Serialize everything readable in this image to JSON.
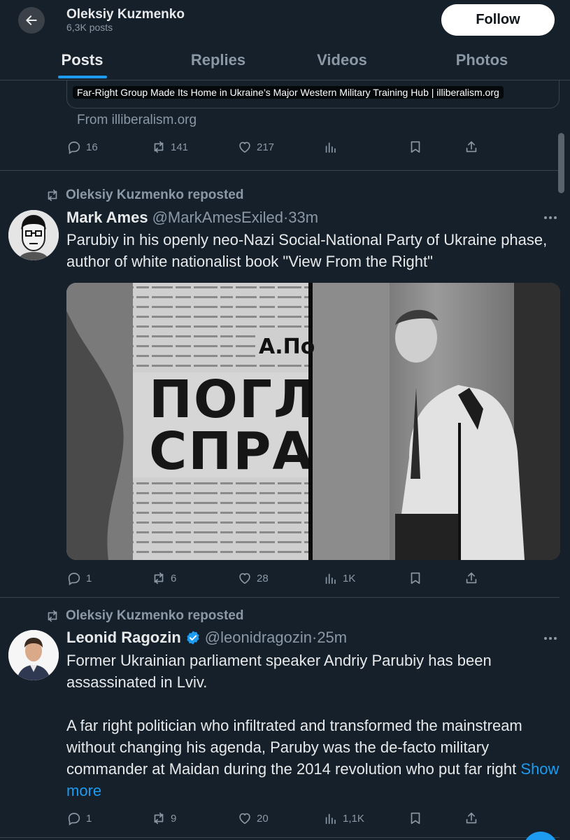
{
  "header": {
    "name": "Oleksiy Kuzmenko",
    "post_count": "6,3K posts",
    "follow_label": "Follow"
  },
  "tabs": [
    {
      "label": "Posts",
      "active": true
    },
    {
      "label": "Replies",
      "active": false
    },
    {
      "label": "Videos",
      "active": false
    },
    {
      "label": "Photos",
      "active": false
    }
  ],
  "top_post": {
    "link_caption": "Far-Right Group Made Its Home in Ukraine’s Major Western Military Training Hub | illiberalism.org",
    "link_from": "From illiberalism.org",
    "replies": "16",
    "reposts": "141",
    "likes": "217",
    "views": ""
  },
  "post1": {
    "repost_label": "Oleksiy Kuzmenko reposted",
    "author": "Mark Ames",
    "handle": "@MarkAmesExiled",
    "dot": "·",
    "time": "33m",
    "text": "Parubiy in his openly neo-Nazi Social-National Party of Ukraine phase, author of white nationalist book \"View From the Right\"",
    "image_text": {
      "author_initial": "А.По",
      "line1": "ПОГЛ",
      "line2": "СПРА"
    },
    "replies": "1",
    "reposts": "6",
    "likes": "28",
    "views": "1K"
  },
  "post2": {
    "repost_label": "Oleksiy Kuzmenko reposted",
    "author": "Leonid Ragozin",
    "handle": "@leonidragozin",
    "dot": "·",
    "time": "25m",
    "text_p1": "Former Ukrainian parliament speaker Andriy Parubiy has been assassinated in Lviv.",
    "text_p2": "A far right politician who infiltrated and transformed the mainstream without changing his agenda, Paruby was the de-facto military commander at Maidan during the 2014 revolution who put far right",
    "show_more": "Show more",
    "replies": "1",
    "reposts": "9",
    "likes": "20",
    "views": "1,1K"
  },
  "colors": {
    "background": "#15202b",
    "accent": "#1d9bf0",
    "muted": "#8b98a5",
    "border": "#38444d"
  },
  "icons": [
    "back-arrow-icon",
    "reply-icon",
    "repost-icon",
    "like-icon",
    "views-icon",
    "bookmark-icon",
    "share-icon",
    "more-icon",
    "verified-icon"
  ]
}
